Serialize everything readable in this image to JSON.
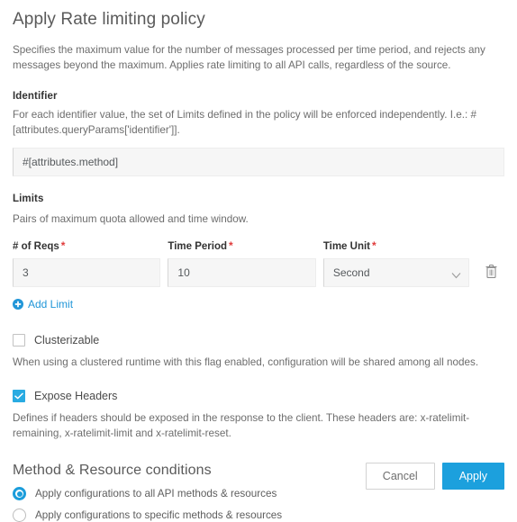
{
  "dialog": {
    "title": "Apply Rate limiting policy",
    "intro": "Specifies the maximum value for the number of messages processed per time period, and rejects any messages beyond the maximum. Applies rate limiting to all API calls, regardless of the source."
  },
  "identifier": {
    "heading": "Identifier",
    "description": "For each identifier value, the set of Limits defined in the policy will be enforced independently. I.e.: #[attributes.queryParams['identifier']].",
    "value": "#[attributes.method]",
    "placeholder": ""
  },
  "limits": {
    "heading": "Limits",
    "description": "Pairs of maximum quota allowed and time window.",
    "required_marker": "*",
    "columns": [
      {
        "label": "# of Reqs",
        "required": true,
        "value": "3",
        "type": "text"
      },
      {
        "label": "Time Period",
        "required": true,
        "value": "10",
        "type": "text"
      },
      {
        "label": "Time Unit",
        "required": true,
        "value": "Second",
        "type": "select"
      }
    ],
    "time_unit_options": [
      "Second"
    ],
    "delete_icon": "trash-icon",
    "add_link": {
      "label": "Add Limit",
      "icon": "plus-circle-icon"
    }
  },
  "options": [
    {
      "label": "Clusterizable",
      "checked": false,
      "description": "When using a clustered runtime with this flag enabled, configuration will be shared among all nodes."
    },
    {
      "label": "Expose Headers",
      "checked": true,
      "description": "Defines if headers should be exposed in the response to the client. These headers are: x-ratelimit-remaining, x-ratelimit-limit and x-ratelimit-reset."
    }
  ],
  "method_resource": {
    "heading": "Method & Resource conditions",
    "radios": [
      {
        "label": "Apply configurations to all API methods & resources",
        "selected": true
      },
      {
        "label": "Apply configurations to specific methods & resources",
        "selected": false
      }
    ]
  },
  "footer": {
    "cancel_label": "Cancel",
    "apply_label": "Apply"
  },
  "colors": {
    "accent": "#1ca0dd",
    "checkbox_checked": "#29abe2",
    "link": "#2196d8",
    "required_asterisk": "#e03b3b",
    "field_background": "#f6f6f6"
  }
}
